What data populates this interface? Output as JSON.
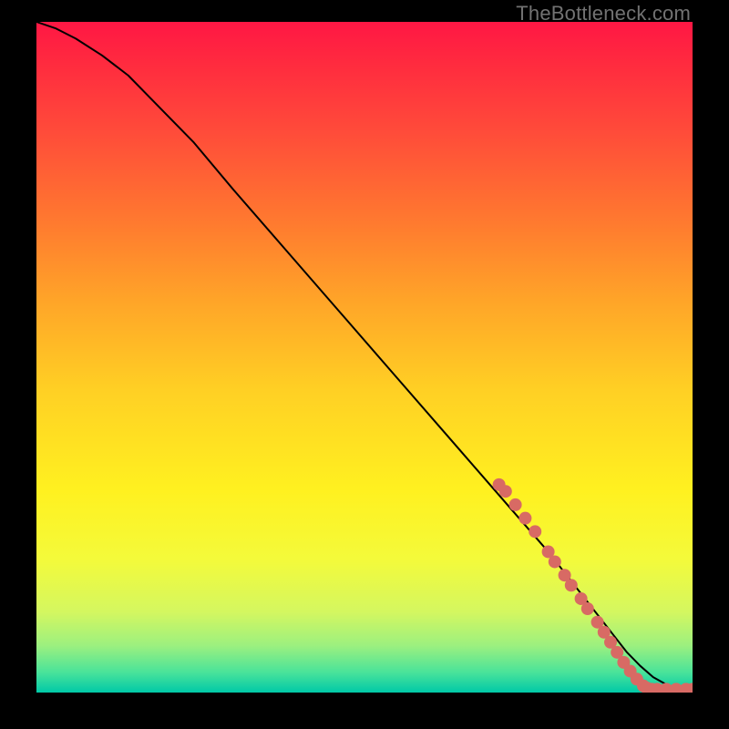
{
  "watermark": "TheBottleneck.com",
  "chart_data": {
    "type": "line",
    "title": "",
    "xlabel": "",
    "ylabel": "",
    "xlim": [
      0,
      100
    ],
    "ylim": [
      0,
      100
    ],
    "grid": false,
    "series": [
      {
        "name": "curve",
        "x": [
          0,
          3,
          6,
          10,
          14,
          18,
          24,
          30,
          38,
          46,
          54,
          62,
          70,
          78,
          82,
          86,
          88,
          90,
          92,
          94,
          96,
          98,
          100
        ],
        "y": [
          100,
          99,
          97.5,
          95,
          92,
          88,
          82,
          75,
          66,
          57,
          48,
          39,
          30,
          21,
          16,
          11,
          8.5,
          6,
          4,
          2.3,
          1.2,
          0.5,
          0.5
        ],
        "color": "#000000",
        "linewidth": 2
      }
    ],
    "highlight_points": {
      "name": "highlight",
      "color": "#d86a64",
      "radius": 7,
      "points": [
        {
          "x": 70.5,
          "y": 31
        },
        {
          "x": 71.5,
          "y": 30
        },
        {
          "x": 73,
          "y": 28
        },
        {
          "x": 74.5,
          "y": 26
        },
        {
          "x": 76,
          "y": 24
        },
        {
          "x": 78,
          "y": 21
        },
        {
          "x": 79,
          "y": 19.5
        },
        {
          "x": 80.5,
          "y": 17.5
        },
        {
          "x": 81.5,
          "y": 16
        },
        {
          "x": 83,
          "y": 14
        },
        {
          "x": 84,
          "y": 12.5
        },
        {
          "x": 85.5,
          "y": 10.5
        },
        {
          "x": 86.5,
          "y": 9
        },
        {
          "x": 87.5,
          "y": 7.5
        },
        {
          "x": 88.5,
          "y": 6
        },
        {
          "x": 89.5,
          "y": 4.5
        },
        {
          "x": 90.5,
          "y": 3.2
        },
        {
          "x": 91.5,
          "y": 2
        },
        {
          "x": 92.5,
          "y": 1
        },
        {
          "x": 93,
          "y": 0.7
        },
        {
          "x": 93.8,
          "y": 0.5
        },
        {
          "x": 94.6,
          "y": 0.5
        },
        {
          "x": 96,
          "y": 0.5
        },
        {
          "x": 97.5,
          "y": 0.5
        },
        {
          "x": 99,
          "y": 0.5
        },
        {
          "x": 100,
          "y": 0.5
        }
      ]
    }
  }
}
